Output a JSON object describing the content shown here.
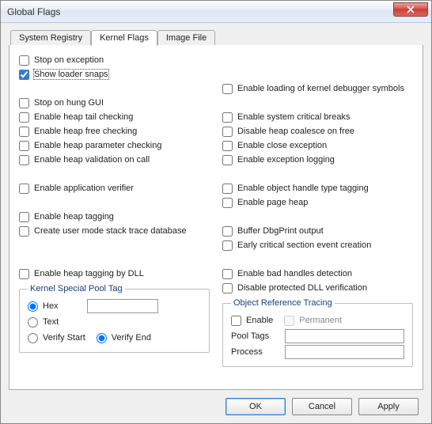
{
  "window": {
    "title": "Global Flags"
  },
  "tabs": {
    "items": [
      {
        "label": "System Registry"
      },
      {
        "label": "Kernel Flags"
      },
      {
        "label": "Image File"
      }
    ],
    "active_index": 1
  },
  "left": {
    "stop_on_exception": "Stop on exception",
    "show_loader_snaps": "Show loader snaps",
    "stop_on_hung_gui": "Stop on hung GUI",
    "enable_heap_tail_checking": "Enable heap tail checking",
    "enable_heap_free_checking": "Enable heap free checking",
    "enable_heap_parameter_checking": "Enable heap parameter checking",
    "enable_heap_validation_on_call": "Enable heap validation on call",
    "enable_application_verifier": "Enable application verifier",
    "enable_heap_tagging": "Enable heap tagging",
    "create_user_mode_stack_trace_db": "Create user mode stack trace database",
    "enable_heap_tagging_by_dll": "Enable heap tagging by DLL"
  },
  "right": {
    "enable_loading_kernel_dbg_symbols": "Enable loading of kernel debugger symbols",
    "enable_system_critical_breaks": "Enable system critical breaks",
    "disable_heap_coalesce_on_free": "Disable heap coalesce on free",
    "enable_close_exception": "Enable close exception",
    "enable_exception_logging": "Enable exception logging",
    "enable_object_handle_type_tagging": "Enable object handle type tagging",
    "enable_page_heap": "Enable page heap",
    "buffer_dbgprint_output": "Buffer DbgPrint output",
    "early_critical_section_event_creation": "Early critical section event creation",
    "enable_bad_handles_detection": "Enable bad handles detection",
    "disable_protected_dll_verification": "Disable protected DLL verification"
  },
  "kspt": {
    "legend": "Kernel Special Pool Tag",
    "hex": "Hex",
    "text": "Text",
    "verify_start": "Verify Start",
    "verify_end": "Verify End",
    "tag_value": ""
  },
  "ort": {
    "legend": "Object Reference Tracing",
    "enable": "Enable",
    "permanent": "Permanent",
    "pool_tags_label": "Pool Tags",
    "process_label": "Process",
    "pool_tags_value": "",
    "process_value": ""
  },
  "buttons": {
    "ok": "OK",
    "cancel": "Cancel",
    "apply": "Apply"
  },
  "checked": {
    "show_loader_snaps": true
  },
  "radios": {
    "kspt_mode": "hex",
    "kspt_verify": "end"
  }
}
